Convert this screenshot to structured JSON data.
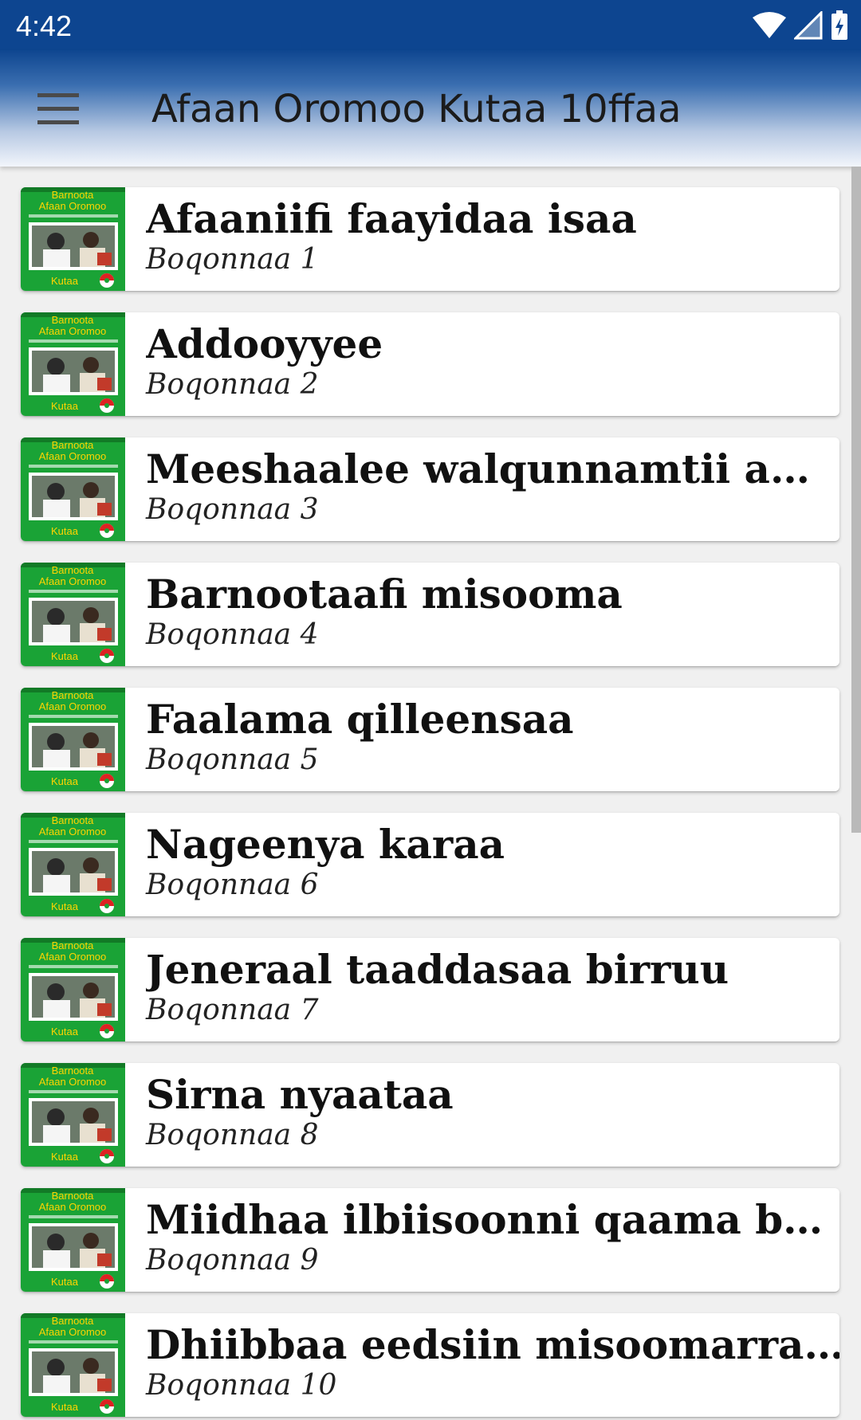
{
  "status_bar": {
    "time": "4:42",
    "icons": [
      "wifi-icon",
      "cell-signal-icon",
      "battery-charging-icon"
    ]
  },
  "app_bar": {
    "title": "Afaan Oromoo Kutaa 10ffaa",
    "menu_icon": "hamburger-menu-icon"
  },
  "thumbnail": {
    "line1": "Barnoota",
    "line2": "Afaan Oromoo",
    "line3": "Kutaa",
    "bg_color": "#1aa336"
  },
  "colors": {
    "status_bar": "#0d4590",
    "accent": "#1aa336"
  },
  "chapters": [
    {
      "title": "Afaaniifi faayidaa isaa",
      "subtitle": "Boqonnaa 1"
    },
    {
      "title": "Addooyyee",
      "subtitle": "Boqonnaa 2"
    },
    {
      "title": "Meeshaalee walqunnamtii ammayyaa",
      "subtitle": "Boqonnaa 3"
    },
    {
      "title": "Barnootaafi misooma",
      "subtitle": "Boqonnaa 4"
    },
    {
      "title": "Faalama qilleensaa",
      "subtitle": "Boqonnaa 5"
    },
    {
      "title": "Nageenya karaa",
      "subtitle": "Boqonnaa 6"
    },
    {
      "title": "Jeneraal taaddasaa birruu",
      "subtitle": "Boqonnaa 7"
    },
    {
      "title": "Sirna nyaataa",
      "subtitle": "Boqonnaa 8"
    },
    {
      "title": "Miidhaa ilbiisoonni qaama beeylada",
      "subtitle": "Boqonnaa 9"
    },
    {
      "title": "Dhiibbaa eedsiin misoomarratti fida",
      "subtitle": "Boqonnaa 10"
    }
  ]
}
